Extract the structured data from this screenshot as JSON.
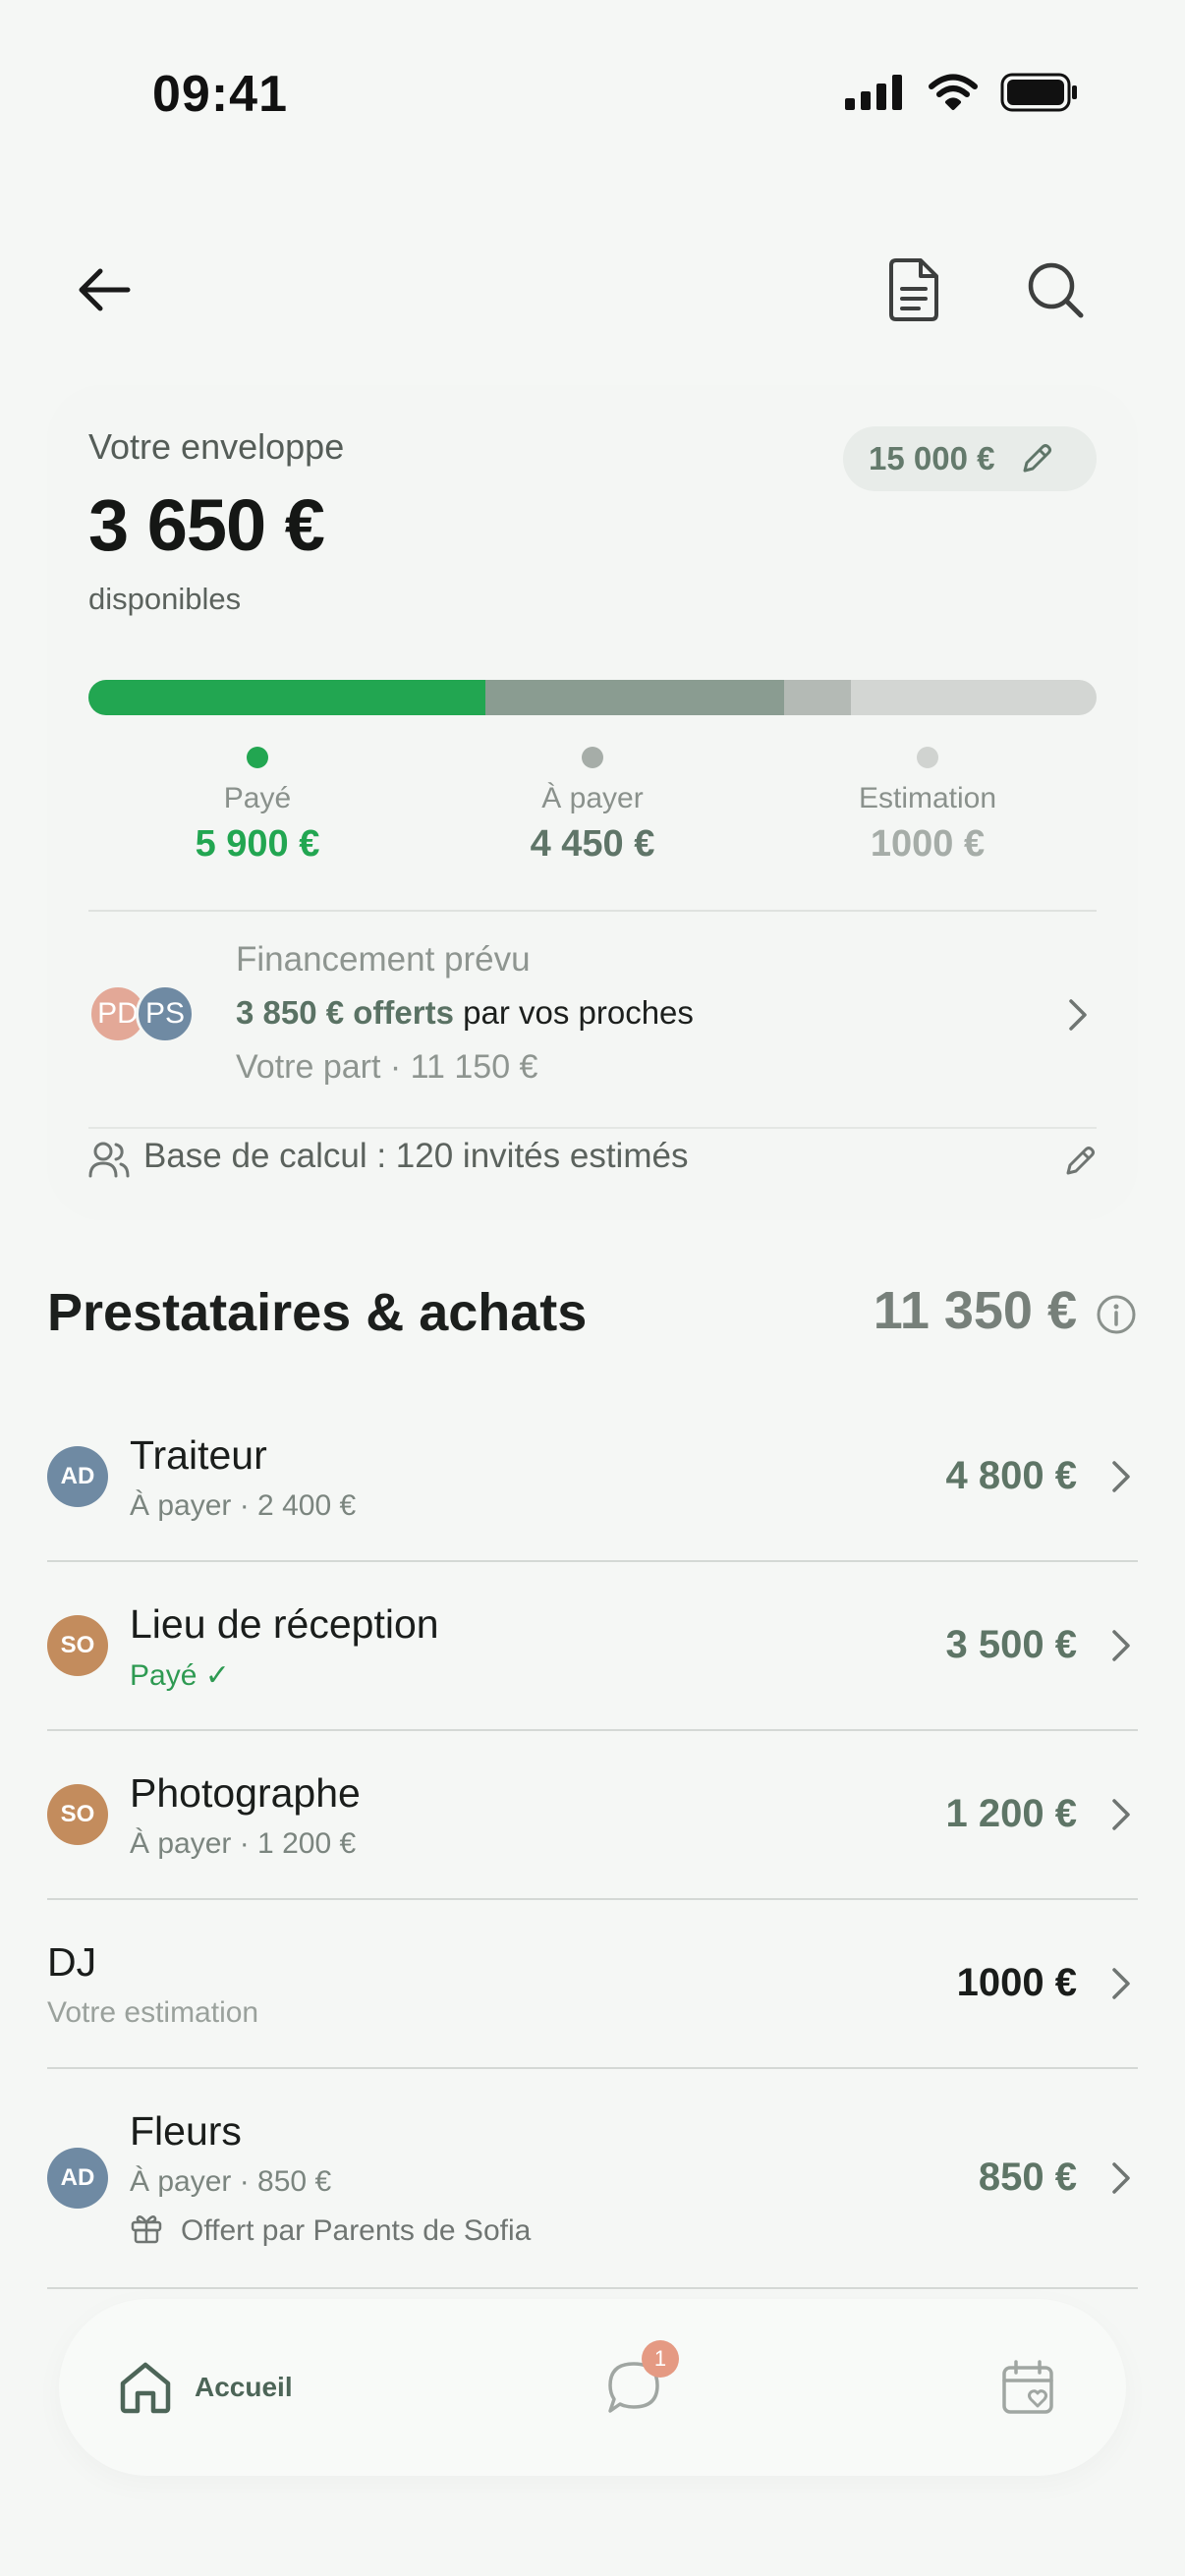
{
  "status": {
    "time": "09:41"
  },
  "envelope": {
    "label": "Votre enveloppe",
    "amount": "3 650 €",
    "sub": "disponibles",
    "total": "15 000 €",
    "progress": {
      "paid": 5900,
      "to_pay": 4450,
      "estimate": 1000,
      "total": 15000
    },
    "colors": {
      "paid": "#22a651",
      "to_pay": "#8a9c91",
      "estimate": "#b4bab5",
      "remaining": "#d3d6d3"
    },
    "legend": [
      {
        "label": "Payé",
        "value": "5 900 €",
        "color": "#22a651"
      },
      {
        "label": "À payer",
        "value": "4 450 €",
        "color": "#5f7568"
      },
      {
        "label": "Estimation",
        "value": "1000 €",
        "color": "#a6ada8"
      }
    ]
  },
  "financing": {
    "title": "Financement prévu",
    "highlight": "3 850 € offerts",
    "rest": " par vos proches",
    "part": "Votre part · 11 150 €",
    "avatars": [
      {
        "initials": "PD",
        "color": "#e3a897"
      },
      {
        "initials": "PS",
        "color": "#6f8aa3"
      }
    ]
  },
  "base": {
    "text": "Base de calcul : 120 invités estimés"
  },
  "section": {
    "title": "Prestataires & achats",
    "total": "11 350 €"
  },
  "vendors": [
    {
      "initials": "AD",
      "avatar_color": "#6f8aa3",
      "name": "Traiteur",
      "status": "À payer · 2 400 €",
      "paid": false,
      "amount": "4 800 €",
      "amount_color": "#5e7566"
    },
    {
      "initials": "SO",
      "avatar_color": "#c38c5d",
      "name": "Lieu de réception",
      "status": "Payé ✓",
      "paid": true,
      "amount": "3 500 €",
      "amount_color": "#5e7566"
    },
    {
      "initials": "SO",
      "avatar_color": "#c38c5d",
      "name": "Photographe",
      "status": "À payer · 1 200 €",
      "paid": false,
      "amount": "1 200 €",
      "amount_color": "#5e7566"
    },
    {
      "initials": "",
      "avatar_color": "",
      "name": "DJ",
      "status": "Votre estimation",
      "paid": false,
      "amount": "1000 €",
      "amount_color": "#1a1d1b"
    },
    {
      "initials": "AD",
      "avatar_color": "#6f8aa3",
      "name": "Fleurs",
      "status": "À payer · 850 €",
      "paid": false,
      "amount": "850 €",
      "amount_color": "#5e7566",
      "gift": "Offert par Parents de Sofia"
    }
  ],
  "nav": {
    "home_label": "Accueil",
    "messages_badge": "1"
  }
}
